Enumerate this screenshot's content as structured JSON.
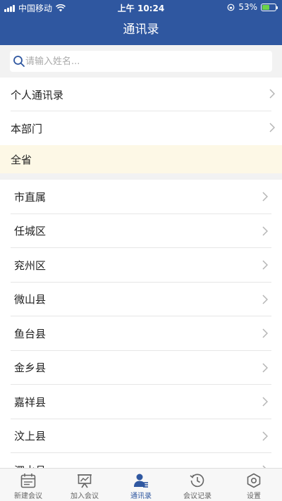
{
  "status_bar": {
    "carrier": "中国移动",
    "time": "上午 10:24",
    "battery_text": "53%",
    "battery_level": 0.53
  },
  "nav": {
    "title": "通讯录"
  },
  "search": {
    "placeholder": "请输入姓名..."
  },
  "top_menu": [
    {
      "label": "个人通讯录"
    },
    {
      "label": "本部门"
    }
  ],
  "province": {
    "label": "全省"
  },
  "regions": [
    "市直属",
    "任城区",
    "兖州区",
    "微山县",
    "鱼台县",
    "金乡县",
    "嘉祥县",
    "汶上县",
    "泗水县"
  ],
  "tabs": [
    {
      "label": "新建会议",
      "icon": "calendar-icon"
    },
    {
      "label": "加入会议",
      "icon": "presentation-icon"
    },
    {
      "label": "通讯录",
      "icon": "contacts-icon",
      "active": true
    },
    {
      "label": "会议记录",
      "icon": "history-icon"
    },
    {
      "label": "设置",
      "icon": "settings-icon"
    }
  ],
  "colors": {
    "brand": "#2f57a0",
    "highlight_bg": "#fdf8e6",
    "battery": "#6cd34a"
  }
}
